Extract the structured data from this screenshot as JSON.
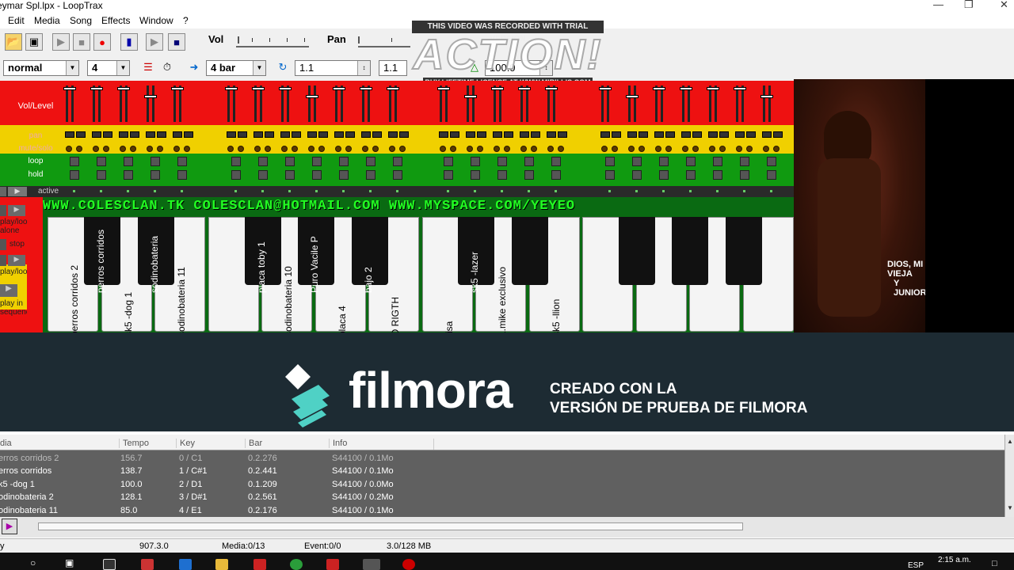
{
  "window": {
    "title": "eymar Spl.lpx - LoopTrax"
  },
  "menu": [
    "Edit",
    "Media",
    "Song",
    "Effects",
    "Window",
    "?"
  ],
  "toolbar": {
    "vol_label": "Vol",
    "pan_label": "Pan"
  },
  "controls": {
    "mode": "normal",
    "beats": "4",
    "bar_length": "4 bar",
    "position1": "1.1",
    "position2": "1.1",
    "tempo": "100.0"
  },
  "watermark_action": {
    "top": "THIS VIDEO WAS RECORDED WITH TRIAL VERSION",
    "logo": "ACTION!",
    "bottom": "BUY LIFETIME LICENSE AT WWW.MIRILLIS.COM"
  },
  "mixer": {
    "row_labels": {
      "vol": "Vol/Level",
      "pan": "pan",
      "mute": "mute/solo",
      "loop": "loop",
      "hold": "hold",
      "active": "active"
    }
  },
  "side_controls": {
    "play_alone": "play/loop alone",
    "stop": "stop",
    "play_loop": "play/loop",
    "play_seq": "play in sequence"
  },
  "banner": "WWW.COLESCLAN.TK   COLESCLAN@HOTMAIL.COM   WWW.MYSPACE.COM/YEYEO",
  "white_keys": [
    "perros corridos 2",
    "sk5 -dog 1",
    "sodinobateria 11",
    "",
    "sodinobateria 10",
    "placa 4",
    "O RIGTH",
    "risa",
    "1.mike exclusivo",
    "sk5 -llion",
    "",
    "",
    "",
    "",
    ""
  ],
  "black_keys": [
    "perros corridos",
    "sodinobateria",
    "placa toby 1",
    "Puro Vacile P",
    "bajo 2",
    "sk5 -lazer",
    "",
    "",
    "",
    ""
  ],
  "photo_caption": {
    "line1": "DIOS, MI VIEJA",
    "line2": "Y JUNIOR"
  },
  "filmora": {
    "logo": "filmora",
    "line1": "CREADO CON LA",
    "line2": "VERSIÓN DE PRUEBA DE FILMORA"
  },
  "list": {
    "headers": [
      "dia",
      "Tempo",
      "Key",
      "Bar",
      "Info"
    ],
    "rows": [
      [
        "erros corridos 2",
        "156.7",
        "0 / C1",
        "0.2.276",
        "S44100 / 0.1Mo"
      ],
      [
        "erros corridos",
        "138.7",
        "1 / C#1",
        "0.2.441",
        "S44100 / 0.1Mo"
      ],
      [
        "k5 -dog 1",
        "100.0",
        "2 / D1",
        "0.1.209",
        "S44100 / 0.0Mo"
      ],
      [
        "odinobateria 2",
        "128.1",
        "3 / D#1",
        "0.2.561",
        "S44100 / 0.2Mo"
      ],
      [
        "odinobateria 11",
        "85.0",
        "4 / E1",
        "0.2.176",
        "S44100 / 0.1Mo"
      ]
    ]
  },
  "status": {
    "s0": "y",
    "s1": "907.3.0",
    "s2": "Media:0/13",
    "s3": "Event:0/0",
    "s4": "3.0/128 MB"
  },
  "taskbar": {
    "lang": "ESP",
    "time": "2:15 a.m."
  }
}
